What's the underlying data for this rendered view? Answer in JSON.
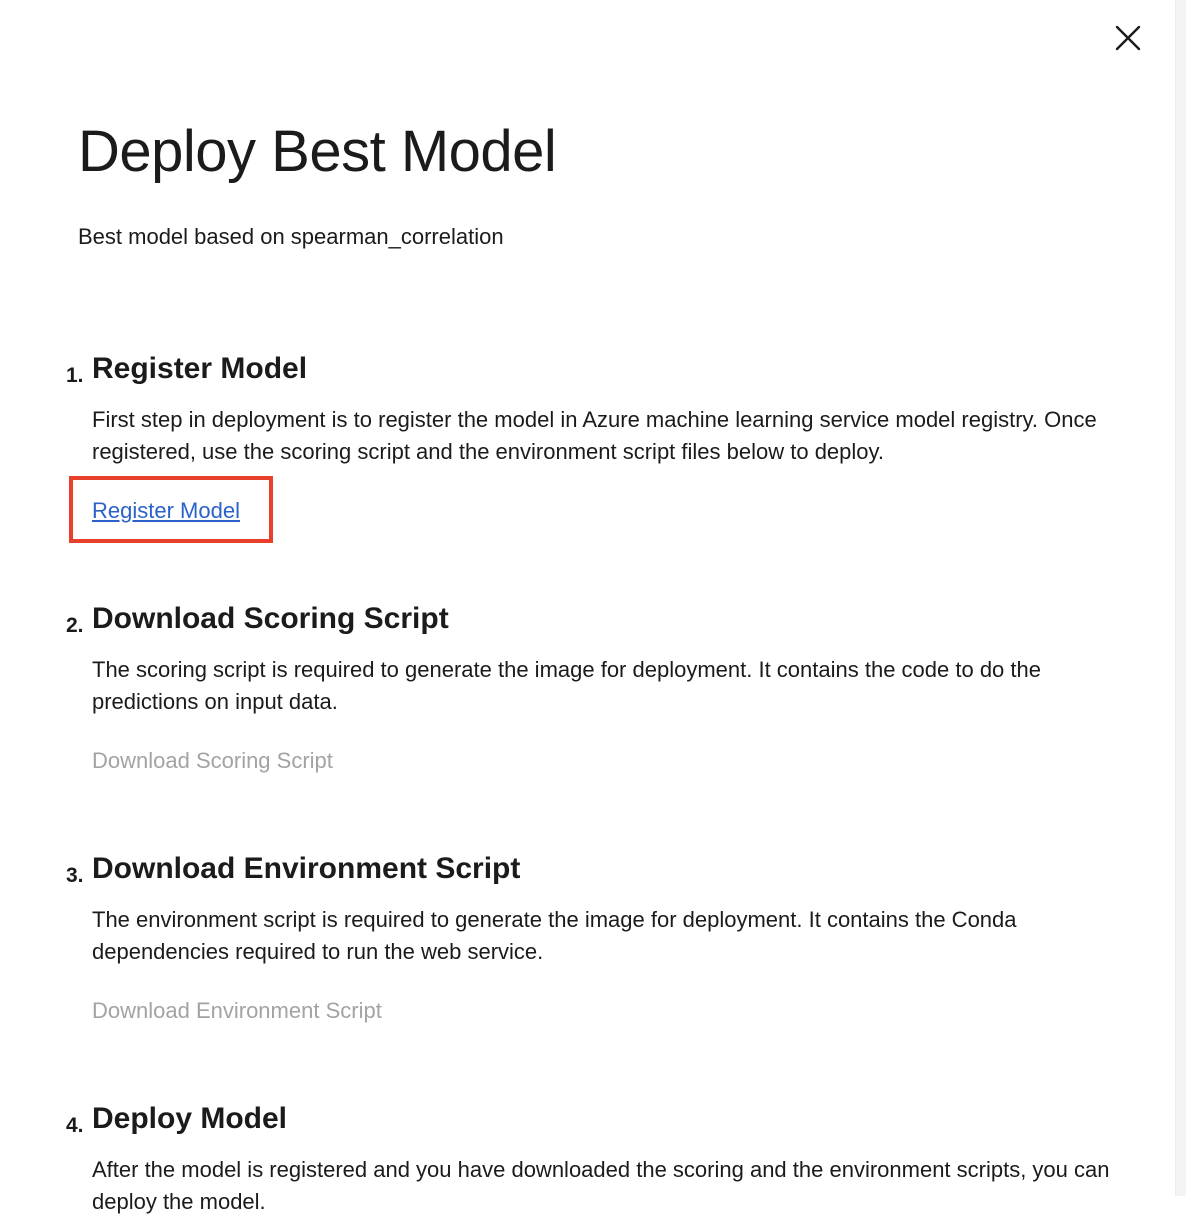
{
  "dialog": {
    "title": "Deploy Best Model",
    "subtitle": "Best model based on spearman_correlation",
    "close_icon": "close-icon"
  },
  "steps": [
    {
      "number": "1.",
      "title": "Register Model",
      "description": "First step in deployment is to register the model in Azure machine learning service model registry. Once registered, use the scoring script and the environment script files below to deploy.",
      "action_label": "Register Model",
      "action_enabled": true
    },
    {
      "number": "2.",
      "title": "Download Scoring Script",
      "description": "The scoring script is required to generate the image for deployment. It contains the code to do the predictions on input data.",
      "action_label": "Download Scoring Script",
      "action_enabled": false
    },
    {
      "number": "3.",
      "title": "Download Environment Script",
      "description": "The environment script is required to generate the image for deployment. It contains the Conda dependencies required to run the web service.",
      "action_label": "Download Environment Script",
      "action_enabled": false
    },
    {
      "number": "4.",
      "title": "Deploy Model",
      "description": "After the model is registered and you have downloaded the scoring and the environment scripts, you can deploy the model."
    }
  ],
  "colors": {
    "link": "#2b62c9",
    "disabled_link": "#a3a3a3",
    "highlight_border": "#e8402c",
    "text": "#1b1b1b"
  }
}
